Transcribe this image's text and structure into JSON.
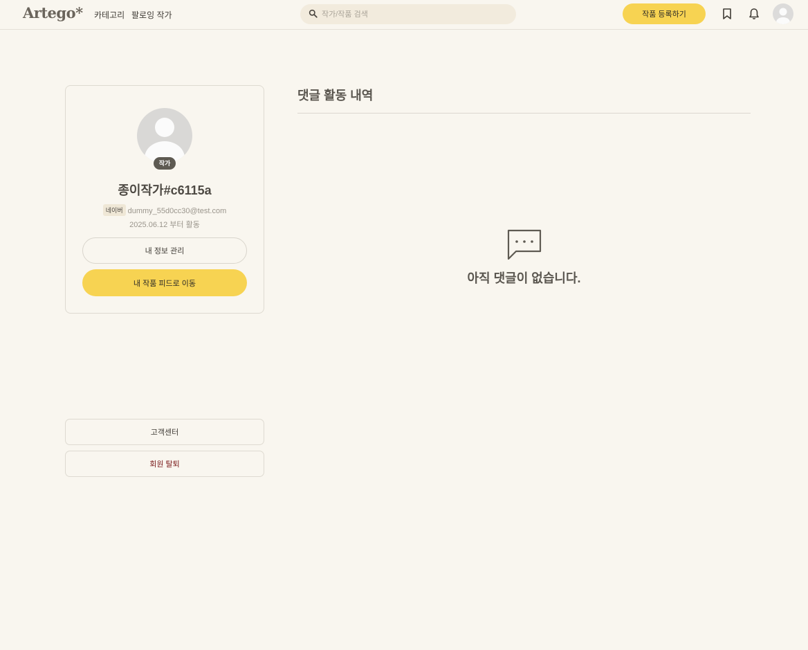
{
  "header": {
    "logo": "Artego*",
    "nav": [
      {
        "label": "카테고리"
      },
      {
        "label": "팔로잉 작가"
      }
    ],
    "search_placeholder": "작가/작품 검색",
    "register_label": "작품 등록하기",
    "icons": [
      "bookmark-icon",
      "bell-icon",
      "avatar"
    ]
  },
  "profile": {
    "role": "작가",
    "nickname": "종이작가#c6115a",
    "provider": "네이버",
    "email": "dummy_55d0cc30@test.com",
    "since": "2025.06.12 부터 활동",
    "manage_label": "내 정보 관리",
    "feed_label": "내 작품 피드로 이동"
  },
  "sidebar": {
    "support_label": "고객센터",
    "withdraw_label": "회원 탈퇴"
  },
  "main": {
    "title": "댓글 활동 내역",
    "empty_message": "아직 댓글이 없습니다."
  },
  "colors": {
    "background": "#f9f6ef",
    "accent": "#f7d352",
    "danger_text": "#7a1a1a"
  }
}
